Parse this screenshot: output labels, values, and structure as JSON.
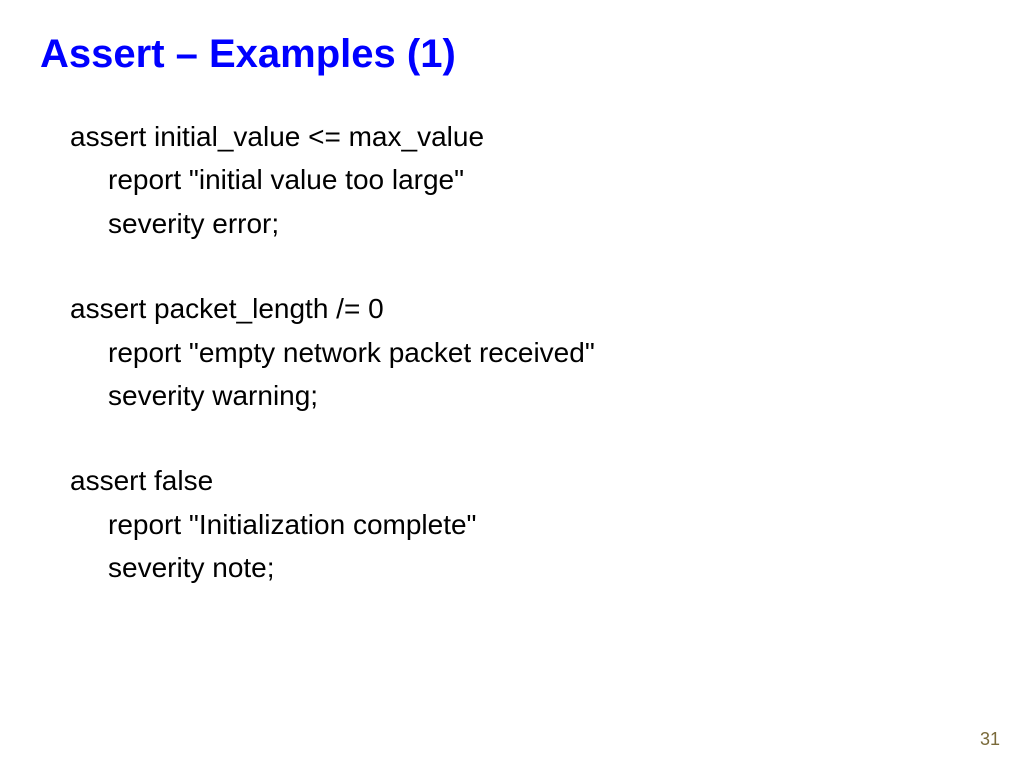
{
  "title": "Assert – Examples (1)",
  "blocks": [
    {
      "line1": "assert initial_value <= max_value",
      "line2": "report \"initial value too large\"",
      "line3": "severity error;"
    },
    {
      "line1": "assert packet_length /= 0",
      "line2": "report \"empty network packet received\"",
      "line3": "severity warning;"
    },
    {
      "line1": "assert false",
      "line2": "report \"Initialization complete\"",
      "line3": "severity note;"
    }
  ],
  "page_number": "31"
}
